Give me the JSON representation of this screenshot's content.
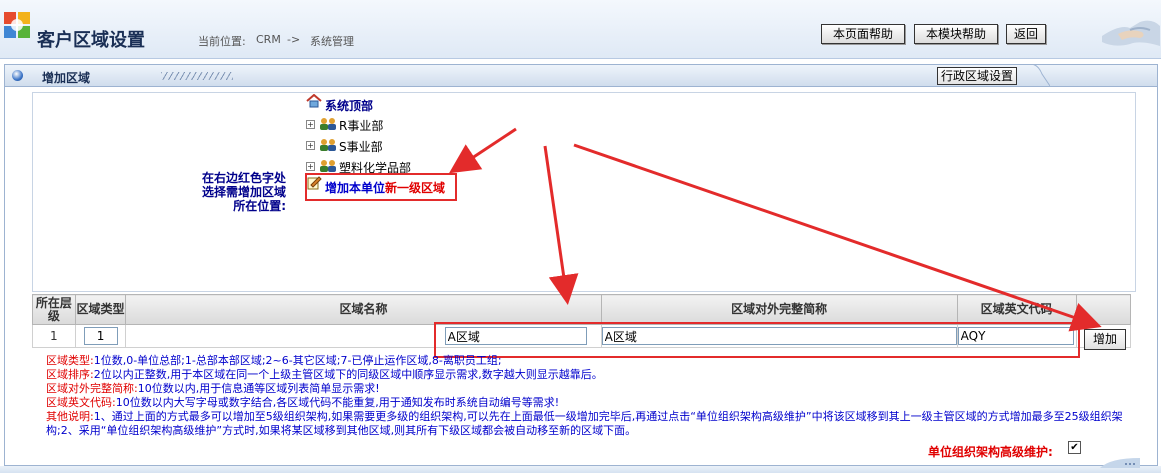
{
  "header": {
    "title": "客户区域设置",
    "breadcrumb_label": "当前位置:",
    "breadcrumb_path": "CRM",
    "breadcrumb_sep": "->",
    "breadcrumb_current": "系统管理",
    "btn_page_help": "本页面帮助",
    "btn_module_help": "本模块帮助",
    "btn_back": "返回"
  },
  "panel": {
    "title": "增加区域",
    "tab_button": "行政区域设置"
  },
  "tree": {
    "root": "系统顶部",
    "nodes": [
      "R事业部",
      "S事业部",
      "塑料化学品部"
    ],
    "hint": "在右边红色字处选择需增加区域所在位置:",
    "add_link_prefix": "增加本单位",
    "add_link_suffix": "新一级区域"
  },
  "form": {
    "headers": [
      "所在层级",
      "区域类型",
      "区域名称",
      "区域对外完整简称",
      "区域英文代码"
    ],
    "level_value": "1",
    "type_value": "1",
    "name_value": "A区域",
    "fullname_value": "A区域",
    "code_value": "AQY",
    "add_button": "增加"
  },
  "notes": [
    {
      "k": "区域类型:",
      "v": "1位数,0-单位总部;1-总部本部区域;2~6-其它区域;7-已停止运作区域,8-离职员工组;"
    },
    {
      "k": "区域排序:",
      "v": "2位以内正整数,用于本区域在同一个上级主管区域下的同级区域中顺序显示需求,数字越大则显示越靠后。"
    },
    {
      "k": "区域对外完整简称:",
      "v": "10位数以内,用于信息通等区域列表简单显示需求!"
    },
    {
      "k": "区域英文代码:",
      "v": "10位数以内大写字母或数字结合,各区域代码不能重复,用于通知发布时系统自动编号等需求!"
    },
    {
      "k": "其他说明:",
      "v": "1、通过上面的方式最多可以增加至5级组织架构,如果需要更多级的组织架构,可以先在上面最低一级增加完毕后,再通过点击“单位组织架构高级维护”中将该区域移到其上一级主管区域的方式增加最多至25级组织架构;2、采用“单位组织架构高级维护”方式时,如果将某区域移到其他区域,则其所有下级区域都会被自动移至新的区域下面。"
    }
  ],
  "footer": {
    "advanced_label": "单位组织架构高级维护:",
    "advanced_checked": true
  },
  "colors": {
    "highlight": "#e32b2b",
    "link_blue": "#00008b",
    "note_key": "#e00000",
    "note_value": "#0000cc"
  }
}
